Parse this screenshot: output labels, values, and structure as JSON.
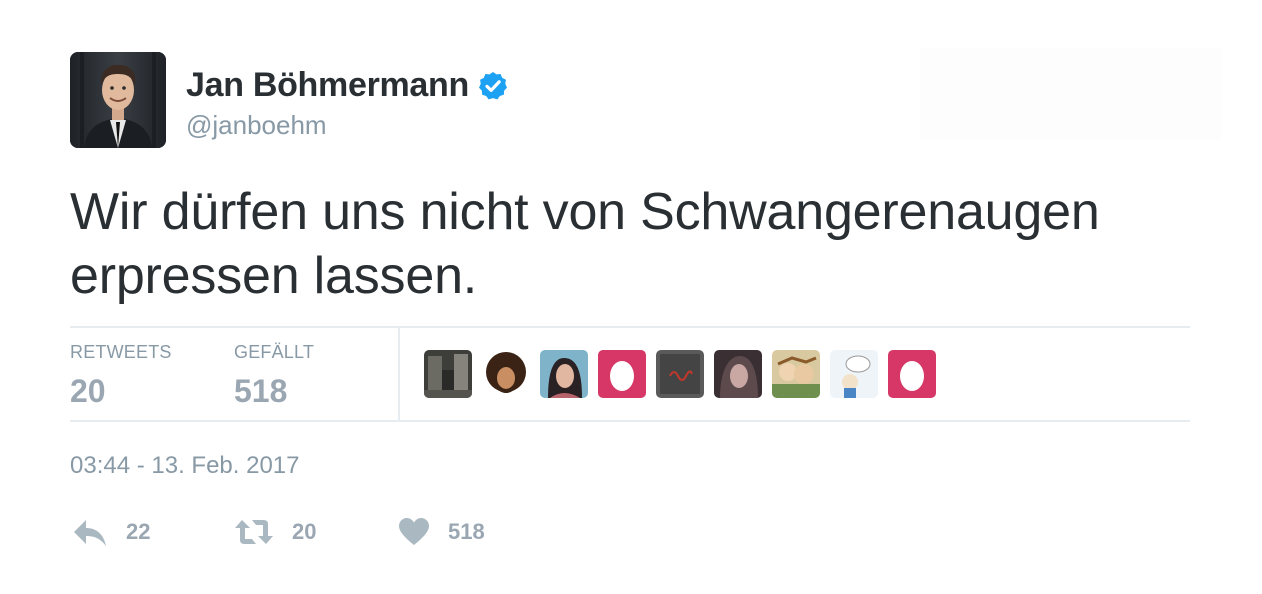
{
  "author": {
    "display_name": "Jan Böhmermann",
    "handle": "@janboehm",
    "verified": true,
    "avatar_icon": "profile-photo"
  },
  "tweet": {
    "text": "Wir dürfen uns nicht von Schwangerenaugen erpressen lassen.",
    "timestamp": "03:44 - 13. Feb. 2017"
  },
  "stats": {
    "retweets_label": "RETWEETS",
    "retweets_value": "20",
    "likes_label": "GEFÄLLT",
    "likes_value": "518"
  },
  "likers": [
    {
      "icon": "street-photo-avatar"
    },
    {
      "icon": "curly-hair-avatar"
    },
    {
      "icon": "woman-portrait-avatar"
    },
    {
      "icon": "default-egg-avatar"
    },
    {
      "icon": "dark-logo-avatar"
    },
    {
      "icon": "woman-dark-portrait-avatar"
    },
    {
      "icon": "comic-avatar"
    },
    {
      "icon": "cartoon-avatar"
    },
    {
      "icon": "default-egg-avatar"
    }
  ],
  "actions": {
    "reply_count": "22",
    "retweet_count": "20",
    "like_count": "518"
  },
  "colors": {
    "verified_blue": "#1da1f2",
    "egg_pink": "#d73767",
    "muted_gray": "#8899a6",
    "text_dark": "#292f33"
  }
}
